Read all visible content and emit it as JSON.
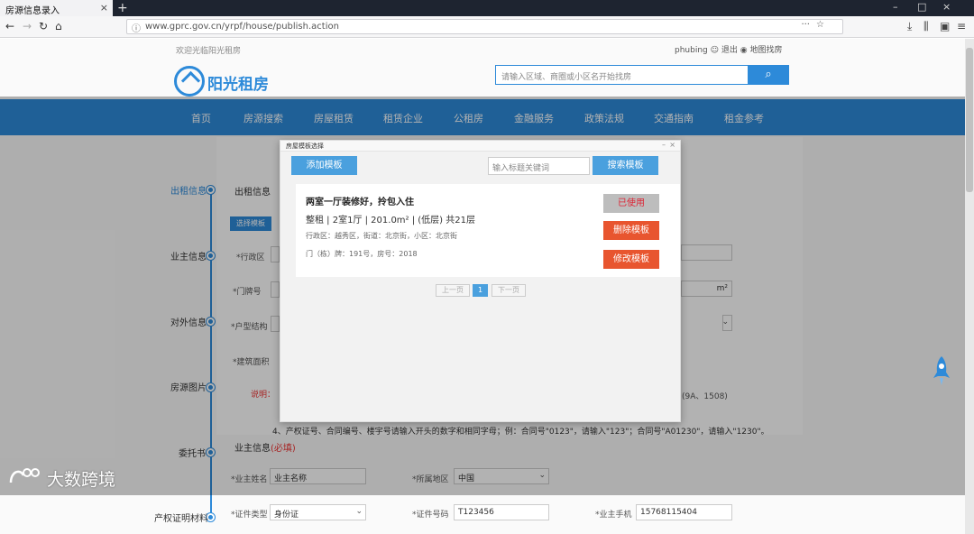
{
  "browser": {
    "tab_title": "房源信息录入",
    "url": "www.gprc.gov.cn/yrpf/house/publish.action",
    "minimize": "–",
    "maximize": "□",
    "close": "×"
  },
  "site": {
    "welcome": "欢迎光临阳光租房",
    "user": "phubing",
    "logout": "退出",
    "map_search": "地图找房",
    "logo_text": "阳光租房",
    "search_placeholder": "请输入区域、商圈或小区名开始找房"
  },
  "nav": [
    "首页",
    "房源搜索",
    "房屋租赁",
    "租赁企业",
    "公租房",
    "金融服务",
    "政策法规",
    "交通指南",
    "租金参考"
  ],
  "steps": [
    {
      "label": "出租信息",
      "active": true
    },
    {
      "label": "业主信息",
      "active": false
    },
    {
      "label": "对外信息",
      "active": false
    },
    {
      "label": "房源图片",
      "active": false
    },
    {
      "label": "委托书",
      "active": false
    },
    {
      "label": "产权证明材料",
      "active": false
    }
  ],
  "form": {
    "section_rent": "出租信息",
    "choose_template": "选择模板",
    "label_district": "*行政区",
    "label_door": "*门牌号",
    "label_floor": "*户型结构",
    "label_area": "*建筑面积",
    "area_unit": "m²",
    "red_hint": "说明：",
    "note_line": "4、产权证号、合同编号、楼宇号请输入开头的数字和相同字母；例：合同号\"0123\"，请输入\"123\"；合同号\"A01230\"，请输入\"1230\"。",
    "note_tail": "(9A、1508)",
    "section_owner": "业主信息",
    "section_owner_tag": "(必填)",
    "owner_name_label": "*业主姓名",
    "owner_name_value": "业主名称",
    "owner_region_label": "*所属地区",
    "owner_region_value": "中国",
    "id_type_label": "*证件类型",
    "id_type_value": "身份证",
    "id_no_label": "*证件号码",
    "id_no_value": "T123456",
    "phone_label": "*业主手机",
    "phone_value": "15768115404"
  },
  "modal": {
    "title": "房屋模板选择",
    "add_button": "添加模板",
    "keyword_placeholder": "输入标题关键词",
    "search_button": "搜索模板",
    "template": {
      "title": "两室一厅装修好，拎包入住",
      "summary": "整租 | 2室1厅 | 201.0m² | (低层) 共21层",
      "location": "行政区：越秀区，街道：北京街，小区：北京街",
      "door": "门（栋）牌：191号，房号：2018",
      "used_button": "已使用",
      "delete_button": "删除模板",
      "edit_button": "修改模板"
    },
    "pager": {
      "prev": "上一页",
      "current": "1",
      "next": "下一页"
    }
  },
  "watermark": "大数跨境"
}
